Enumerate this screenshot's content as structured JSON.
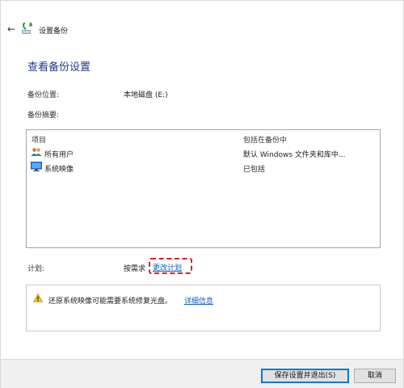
{
  "window": {
    "title": "设置备份"
  },
  "page_title": "查看备份设置",
  "backup_location": {
    "label": "备份位置:",
    "value": "本地磁盘 (E:)"
  },
  "backup_summary": {
    "label": "备份摘要:",
    "columns": [
      "项目",
      "包括在备份中"
    ],
    "rows": [
      {
        "icon": "users-icon",
        "name": "所有用户",
        "included": "默认 Windows 文件夹和库中..."
      },
      {
        "icon": "monitor-icon",
        "name": "系统映像",
        "included": "已包括"
      }
    ]
  },
  "schedule": {
    "label": "计划:",
    "value": "按需求",
    "change_link": "更改计划"
  },
  "warning": {
    "icon": "warning-icon",
    "text": "还原系统映像可能需要系统修复光盘。",
    "link": "详细信息"
  },
  "buttons": {
    "save_exit": "保存设置并退出(S)",
    "cancel": "取消"
  },
  "colors": {
    "title": "#1e3a8f",
    "link": "#0d5fc7",
    "highlight": "#e02020",
    "primary_border": "#0078d7"
  }
}
